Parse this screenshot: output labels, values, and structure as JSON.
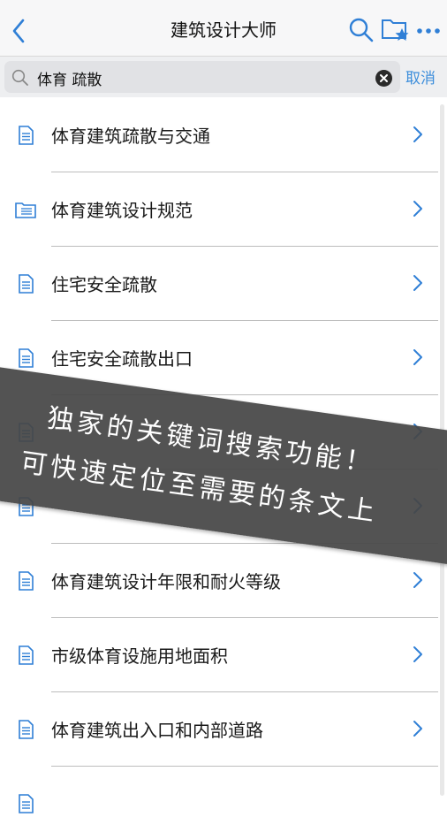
{
  "nav": {
    "title": "建筑设计大师"
  },
  "search": {
    "query": "体育 疏散",
    "cancel_label": "取消"
  },
  "results": [
    {
      "label": "体育建筑疏散与交通",
      "icon": "document-icon"
    },
    {
      "label": "体育建筑设计规范",
      "icon": "folder-list-icon"
    },
    {
      "label": "住宅安全疏散",
      "icon": "document-icon"
    },
    {
      "label": "住宅安全疏散出口",
      "icon": "document-icon"
    },
    {
      "label": "",
      "icon": "document-icon"
    },
    {
      "label": "",
      "icon": "document-icon"
    },
    {
      "label": "体育建筑设计年限和耐火等级",
      "icon": "document-icon"
    },
    {
      "label": "市级体育设施用地面积",
      "icon": "document-icon"
    },
    {
      "label": "体育建筑出入口和内部道路",
      "icon": "document-icon"
    },
    {
      "label": "",
      "icon": "document-icon"
    }
  ],
  "banner": {
    "line1": "独家的关键词搜索功能！",
    "line2": "可快速定位至需要的条文上"
  },
  "colors": {
    "accent": "#3d8edb",
    "banner_bg": "#464646"
  }
}
